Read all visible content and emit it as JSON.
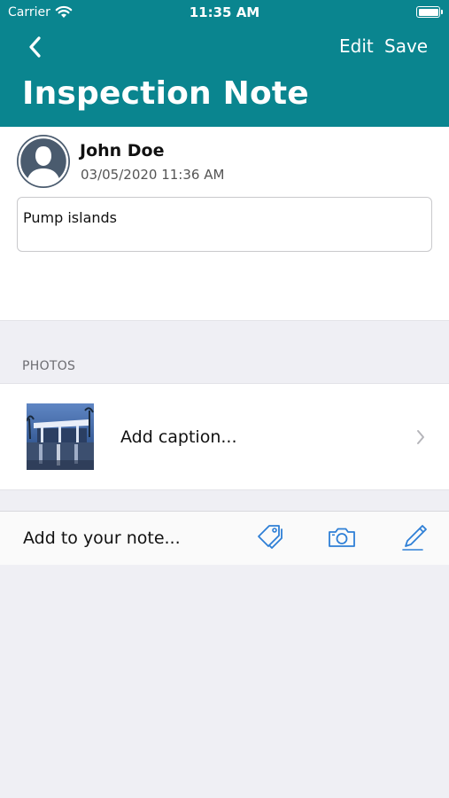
{
  "status_bar": {
    "carrier": "Carrier",
    "time": "11:35 AM"
  },
  "nav": {
    "edit_label": "Edit",
    "save_label": "Save",
    "title": "Inspection Note"
  },
  "note": {
    "author": "John Doe",
    "timestamp": "03/05/2020 11:36 AM",
    "text": "Pump islands"
  },
  "photos": {
    "section_label": "PHOTOS",
    "items": [
      {
        "caption_placeholder": "Add caption..."
      }
    ]
  },
  "toolbar": {
    "add_note_label": "Add to your note..."
  },
  "colors": {
    "header": "#0a858f",
    "accent_icon": "#2e7fd6",
    "background": "#efeff4"
  },
  "icons": [
    "back-chevron-icon",
    "wifi-icon",
    "battery-icon",
    "avatar-icon",
    "chevron-right-icon",
    "tag-icon",
    "camera-icon",
    "pen-icon"
  ]
}
